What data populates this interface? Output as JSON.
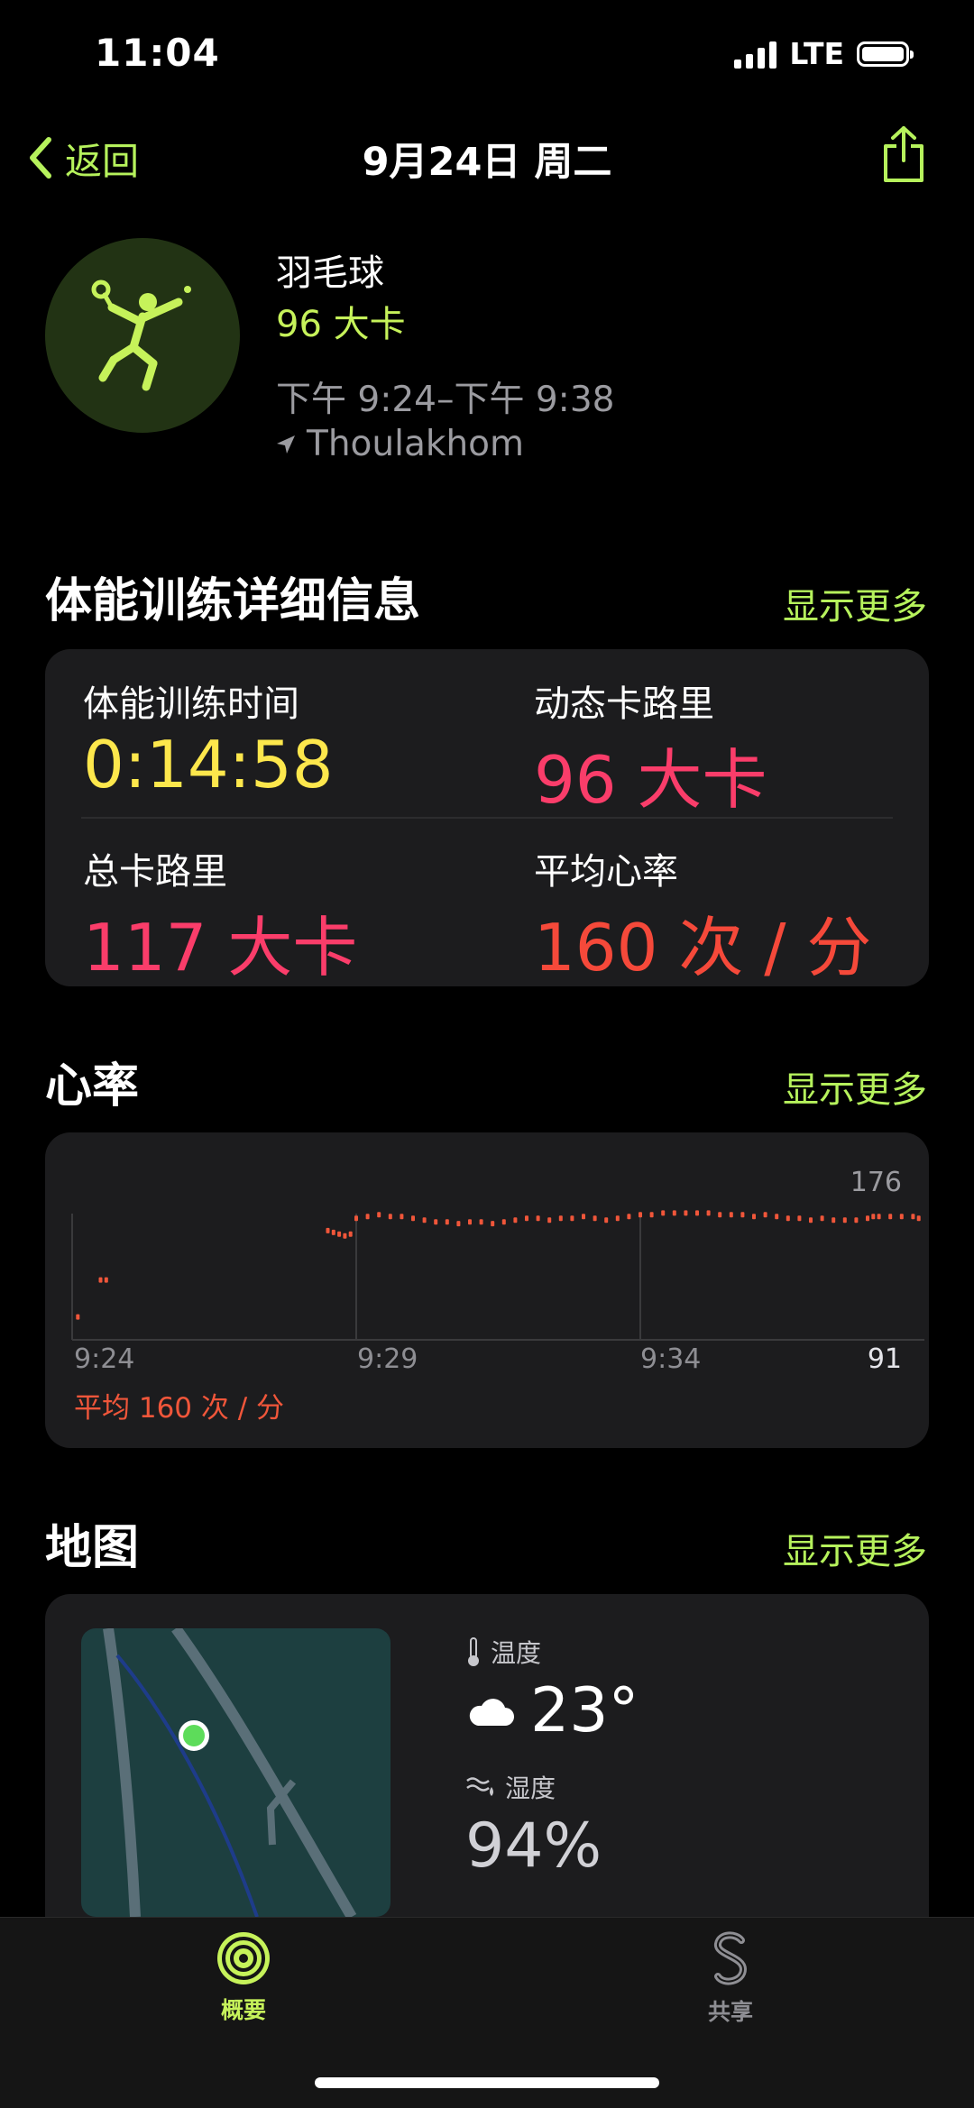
{
  "status_bar": {
    "time": "11:04",
    "network": "LTE"
  },
  "nav": {
    "back_label": "返回",
    "title": "9月24日 周二"
  },
  "workout": {
    "name": "羽毛球",
    "calories": "96 大卡",
    "time_range": "下午 9:24–下午 9:38",
    "location": "Thoulakhom",
    "icon": "badminton-player-icon"
  },
  "details": {
    "title": "体能训练详细信息",
    "show_more": "显示更多",
    "metrics": [
      {
        "label": "体能训练时间",
        "value": "0:14:58",
        "color": "#fde74c"
      },
      {
        "label": "动态卡路里",
        "value": "96 大卡",
        "color": "#fa3d6a"
      },
      {
        "label": "总卡路里",
        "value": "117 大卡",
        "color": "#fa3d6a"
      },
      {
        "label": "平均心率",
        "value": "160 次 / 分",
        "color": "#f5493a"
      }
    ]
  },
  "heart_rate": {
    "title": "心率",
    "show_more": "显示更多",
    "max_label": "176",
    "min_label": "91",
    "average": "平均 160 次 / 分",
    "time_ticks": [
      "9:24",
      "9:29",
      "9:34"
    ]
  },
  "chart_data": {
    "type": "scatter",
    "title": "",
    "xlabel": "",
    "ylabel": "",
    "x_unit": "minutes since 9:24",
    "ylim": [
      91,
      176
    ],
    "x_ticks": [
      "9:24",
      "9:29",
      "9:34"
    ],
    "series": [
      {
        "color": "#f0563a",
        "x": [
          0.1,
          0.5,
          0.6,
          4.5,
          4.6,
          4.7,
          4.8,
          4.9,
          5.0,
          5.2,
          5.4,
          5.6,
          5.8,
          6.0,
          6.2,
          6.4,
          6.6,
          6.8,
          7.0,
          7.2,
          7.4,
          7.6,
          7.8,
          8.0,
          8.2,
          8.4,
          8.6,
          8.8,
          9.0,
          9.2,
          9.4,
          9.6,
          9.8,
          10.0,
          10.2,
          10.4,
          10.6,
          10.8,
          11.0,
          11.2,
          11.4,
          11.6,
          11.8,
          12.0,
          12.2,
          12.4,
          12.6,
          12.8,
          13.0,
          13.2,
          13.4,
          13.6,
          13.8,
          14.0,
          14.1,
          14.2,
          14.4,
          14.6,
          14.8,
          14.9
        ],
        "y": [
          104,
          125,
          125,
          153,
          152,
          151,
          150,
          151,
          160,
          161,
          162,
          161,
          161,
          160,
          159,
          158,
          158,
          157,
          158,
          158,
          157,
          158,
          159,
          160,
          160,
          159,
          160,
          160,
          161,
          160,
          159,
          160,
          161,
          162,
          162,
          163,
          163,
          163,
          163,
          163,
          162,
          162,
          162,
          161,
          162,
          161,
          160,
          160,
          159,
          160,
          159,
          159,
          159,
          160,
          161,
          161,
          161,
          161,
          161,
          160
        ]
      }
    ]
  },
  "map_section": {
    "title": "地图",
    "show_more": "显示更多",
    "temperature_label": "温度",
    "temperature": "23°",
    "humidity_label": "湿度",
    "humidity": "94%"
  },
  "tabs": [
    {
      "label": "概要",
      "color": "#c6f25a"
    },
    {
      "label": "共享",
      "color": "#8e8e93"
    }
  ]
}
